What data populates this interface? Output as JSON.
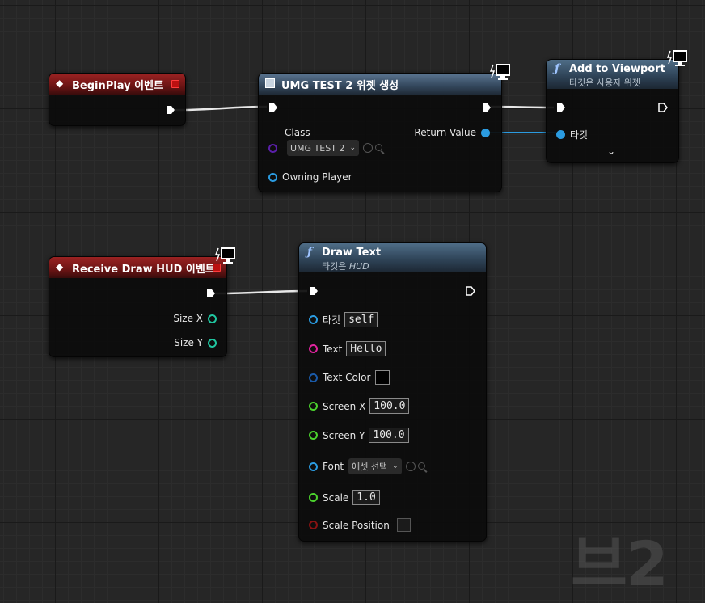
{
  "nodes": {
    "begin_play": {
      "title": "BeginPlay 이벤트"
    },
    "create_widget": {
      "title": "UMG TEST 2 위젯 생성",
      "class_label": "Class",
      "class_value": "UMG TEST 2",
      "return_value_label": "Return Value",
      "owning_player_label": "Owning Player"
    },
    "add_to_viewport": {
      "title": "Add to Viewport",
      "subtitle": "타깃은 사용자 위젯",
      "target_label": "타깃"
    },
    "receive_draw_hud": {
      "title": "Receive Draw HUD 이벤트",
      "size_x_label": "Size X",
      "size_y_label": "Size Y"
    },
    "draw_text": {
      "title": "Draw Text",
      "subtitle_prefix": "타깃은 ",
      "subtitle_target": "HUD",
      "target_label": "타깃",
      "target_value": "self",
      "text_label": "Text",
      "text_value": "Hello",
      "text_color_label": "Text Color",
      "text_color_value": "#000000",
      "screen_x_label": "Screen X",
      "screen_x_value": "100.0",
      "screen_y_label": "Screen Y",
      "screen_y_value": "100.0",
      "font_label": "Font",
      "font_value": "에셋 선택",
      "scale_label": "Scale",
      "scale_value": "1.0",
      "scale_position_label": "Scale Position"
    }
  },
  "icons": {
    "event": "diamond-icon",
    "function": "function-icon",
    "widget": "widget-icon",
    "server_client": "monitor-icon"
  },
  "colors": {
    "event_header": "#8b1c1c",
    "function_header": "#3c5670",
    "object_pin": "#2b9be0",
    "string_pin": "#e0249e",
    "color_pin": "#1a5aa8",
    "float_pin": "#4bd12d",
    "class_pin": "#5a1fa8",
    "bool_pin": "#8a1212",
    "int_pin": "#20c6a0"
  },
  "watermark": "브2"
}
